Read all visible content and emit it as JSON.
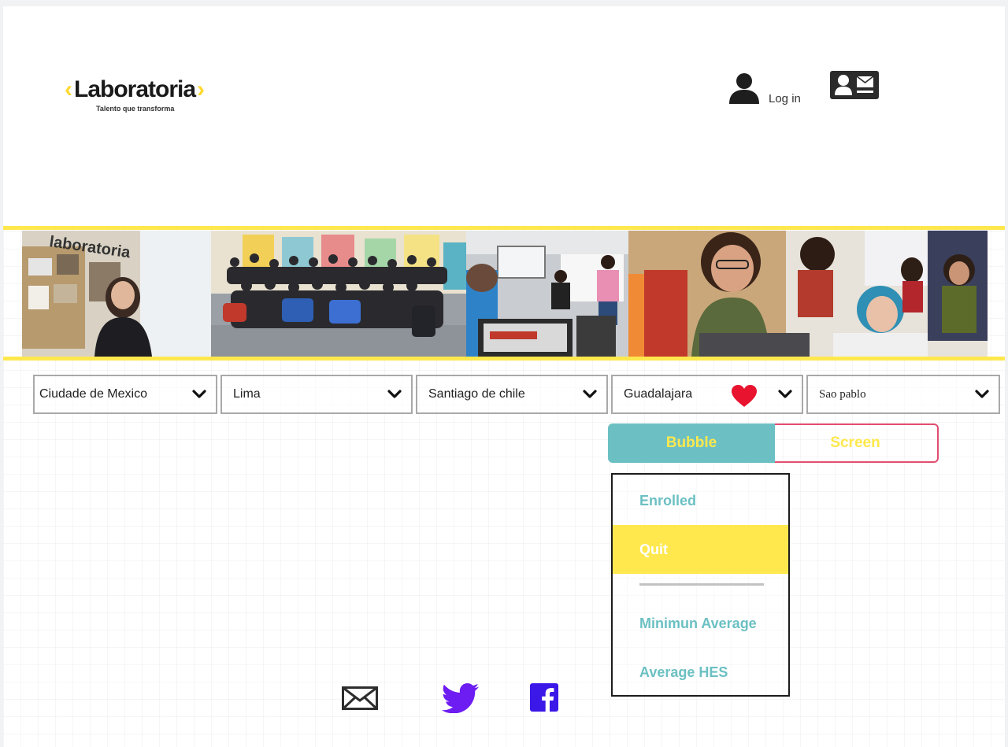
{
  "brand": {
    "name": "Laboratoria",
    "tagline": "Talento que transforma",
    "accent": "#ffe84d"
  },
  "header": {
    "login_label": "Log in"
  },
  "icons": {
    "user": "user-icon",
    "contact": "contact-card-icon",
    "dropdown": "chevron-down-icon",
    "favorite": "heart-icon"
  },
  "cities": [
    {
      "label": "Ciudade de Mexico"
    },
    {
      "label": "Lima"
    },
    {
      "label": "Santiago de chile"
    },
    {
      "label": "Guadalajara"
    },
    {
      "label": "Sao pablo"
    }
  ],
  "view_toggle": {
    "bubble_label": "Bubble",
    "screen_label": "Screen",
    "selected": "Bubble"
  },
  "menu": {
    "items": [
      "Enrolled",
      "Quit",
      "Minimun Average",
      "Average HES"
    ],
    "selected": "Quit"
  },
  "footer": {
    "social": [
      "email-icon",
      "twitter-icon",
      "facebook-icon"
    ]
  },
  "colors": {
    "teal": "#6cc0c3",
    "yellow": "#ffe84d",
    "pink_border": "#e24d70",
    "heart": "#e8132e",
    "twitter": "#6d1cf2",
    "facebook": "#3b17e8"
  }
}
